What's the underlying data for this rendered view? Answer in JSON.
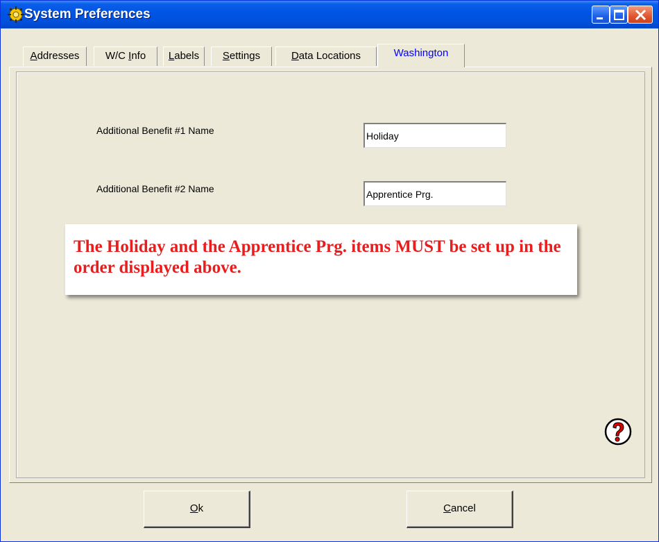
{
  "window": {
    "title": "System Preferences"
  },
  "tabs": [
    {
      "label": "Addresses",
      "accel": "A",
      "rest": "ddresses"
    },
    {
      "label": "W/C Info",
      "pre": "W/C ",
      "accel": "I",
      "rest": "nfo"
    },
    {
      "label": "Labels",
      "accel": "L",
      "rest": "abels"
    },
    {
      "label": "Settings",
      "accel": "S",
      "rest": "ettings"
    },
    {
      "label": "Data Locations",
      "accel": "D",
      "rest": "ata Locations"
    },
    {
      "label": "Washington",
      "active": true
    }
  ],
  "fields": {
    "benefit1": {
      "label": "Additional Benefit #1 Name",
      "value": "Holiday"
    },
    "benefit2": {
      "label": "Additional Benefit #2 Name",
      "value": "Apprentice Prg."
    }
  },
  "note": {
    "text": "The Holiday and the Apprentice Prg. items MUST be set up in the order displayed above."
  },
  "buttons": {
    "ok": {
      "accel": "O",
      "rest": "k"
    },
    "cancel": {
      "accel": "C",
      "rest": "ancel"
    }
  },
  "colors": {
    "note_text": "#e81e1e",
    "active_tab_text": "#0000ff",
    "titlebar": "#0054e3"
  },
  "icons": {
    "title": "preferences-gear-icon",
    "help": "help-question-icon"
  }
}
